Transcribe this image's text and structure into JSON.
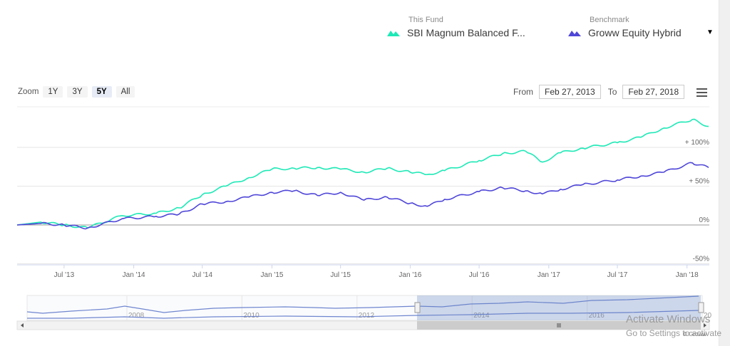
{
  "legend": {
    "fund": {
      "caption": "This Fund",
      "name": "SBI Magnum Balanced F...",
      "color": "#1de9b6",
      "icon": "mountain-icon"
    },
    "benchmark": {
      "caption": "Benchmark",
      "name": "Groww Equity Hybrid",
      "color": "#4f46d8",
      "icon": "mountain-icon",
      "dropdown_icon": "caret-down-icon"
    }
  },
  "range_selector": {
    "zoom_label": "Zoom",
    "buttons": [
      "1Y",
      "3Y",
      "5Y",
      "All"
    ],
    "active": "5Y",
    "from_label": "From",
    "from": "Feb 27, 2013",
    "to_label": "To",
    "to": "Feb 27, 2018",
    "menu_icon": "hamburger-icon"
  },
  "chart_data": {
    "type": "line",
    "xlim": [
      "2013-02-27",
      "2018-02-27"
    ],
    "ylim": [
      -50,
      130
    ],
    "x_ticks": [
      "Jul '13",
      "Jan '14",
      "Jul '14",
      "Jan '15",
      "Jul '15",
      "Jan '16",
      "Jul '16",
      "Jan '17",
      "Jul '17",
      "Jan '18"
    ],
    "y_ticks": [
      "+ 100%",
      "+ 50%",
      "0%",
      "-50%"
    ],
    "grid": true,
    "series": [
      {
        "name": "SBI Magnum Balanced F...",
        "color": "#1de9b6",
        "x": [
          "2013-02-27",
          "2013-05-01",
          "2013-07-01",
          "2013-09-01",
          "2013-12-01",
          "2014-03-01",
          "2014-05-01",
          "2014-07-01",
          "2014-09-01",
          "2014-11-01",
          "2015-01-01",
          "2015-03-01",
          "2015-05-01",
          "2015-07-01",
          "2015-09-01",
          "2015-11-01",
          "2016-01-01",
          "2016-02-15",
          "2016-04-01",
          "2016-07-01",
          "2016-09-01",
          "2016-11-01",
          "2016-12-15",
          "2017-02-01",
          "2017-04-01",
          "2017-07-01",
          "2017-09-01",
          "2017-11-01",
          "2018-01-15",
          "2018-02-27"
        ],
        "y": [
          0,
          3.7,
          0,
          -3.7,
          12,
          15,
          22,
          39,
          50,
          61,
          72,
          73,
          74,
          72,
          68,
          73,
          68,
          65,
          70,
          83,
          92,
          95,
          81,
          93,
          99,
          106,
          113,
          125,
          136,
          127
        ]
      },
      {
        "name": "Groww Equity Hybrid",
        "color": "#4f46d8",
        "x": [
          "2013-02-27",
          "2013-05-01",
          "2013-07-01",
          "2013-09-01",
          "2013-12-01",
          "2014-03-01",
          "2014-05-01",
          "2014-07-01",
          "2014-09-01",
          "2014-11-01",
          "2015-01-01",
          "2015-03-01",
          "2015-05-01",
          "2015-07-01",
          "2015-09-01",
          "2015-11-01",
          "2016-01-01",
          "2016-02-15",
          "2016-04-01",
          "2016-07-01",
          "2016-09-01",
          "2016-11-01",
          "2016-12-15",
          "2017-02-01",
          "2017-04-01",
          "2017-07-01",
          "2017-09-01",
          "2017-11-01",
          "2018-01-15",
          "2018-02-27"
        ],
        "y": [
          0,
          2,
          0,
          -4,
          8,
          11,
          14,
          27,
          30,
          36,
          42,
          44,
          38,
          42,
          32,
          36,
          28,
          24,
          33,
          43,
          48,
          44,
          40,
          46,
          52,
          58,
          63,
          68,
          80,
          74
        ]
      }
    ]
  },
  "navigator": {
    "ticks": [
      "2008",
      "2010",
      "2012",
      "2014",
      "2016",
      "20"
    ],
    "handle_icon": "grip-icon"
  },
  "watermark": {
    "line1": "Activate Windows",
    "line2": "Go to Settings to activate",
    "credit": "© Groww"
  }
}
